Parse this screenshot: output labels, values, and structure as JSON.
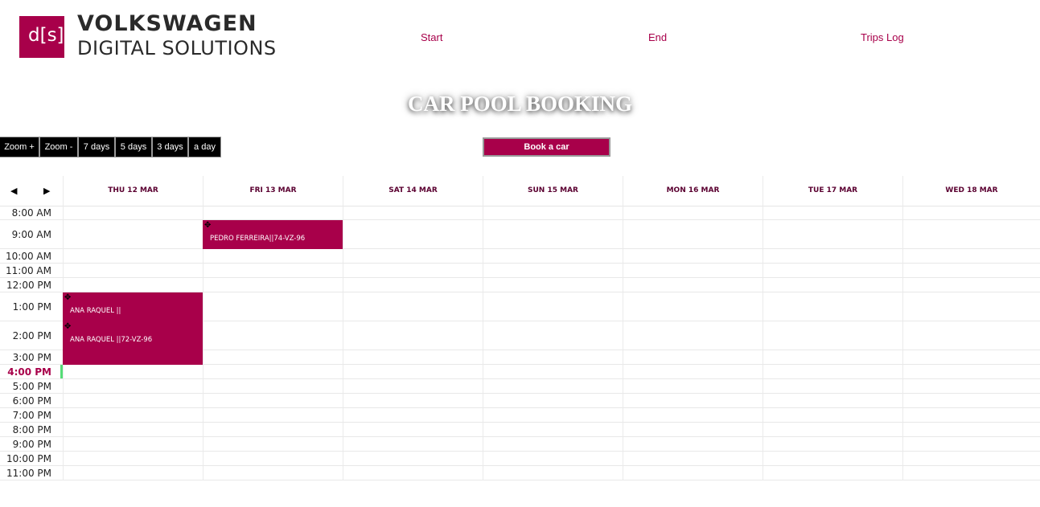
{
  "logo": {
    "mark": "d[s]",
    "line1": "VOLKSWAGEN",
    "line2": "DIGITAL SOLUTIONS"
  },
  "nav": {
    "start": "Start",
    "end": "End",
    "trips_log": "Trips Log"
  },
  "title": "CAR POOL BOOKING",
  "toolbar": {
    "zoom_in": "Zoom +",
    "zoom_out": "Zoom -",
    "seven_days": "7 days",
    "five_days": "5 days",
    "three_days": "3 days",
    "a_day": "a day",
    "book": "Book a car"
  },
  "calendar": {
    "prev_icon": "◀",
    "next_icon": "▶",
    "days": [
      "THU 12 MAR",
      "FRI 13 MAR",
      "SAT 14 MAR",
      "SUN 15 MAR",
      "MON 16 MAR",
      "TUE 17 MAR",
      "WED 18 MAR"
    ],
    "times": [
      "8:00 AM",
      "9:00 AM",
      "10:00 AM",
      "11:00 AM",
      "12:00 PM",
      "1:00 PM",
      "2:00 PM",
      "3:00 PM",
      "4:00 PM",
      "5:00 PM",
      "6:00 PM",
      "7:00 PM",
      "8:00 PM",
      "9:00 PM",
      "10:00 PM",
      "11:00 PM"
    ],
    "current_time": "4:00 PM",
    "events": [
      {
        "label": "PEDRO FERREIRA||74-VZ-96",
        "day": "FRI 13 MAR",
        "start": "9:00 AM"
      },
      {
        "label": "ANA RAQUEL ||",
        "day": "THU 12 MAR",
        "start": "1:00 PM"
      },
      {
        "label": "ANA RAQUEL ||72-VZ-96",
        "day": "THU 12 MAR",
        "start": "2:00 PM",
        "end": "3:00 PM"
      }
    ],
    "move_icon": "✥"
  },
  "colors": {
    "accent": "#a8004a",
    "now_marker": "#55dd77",
    "title_shadow": "#555555"
  }
}
